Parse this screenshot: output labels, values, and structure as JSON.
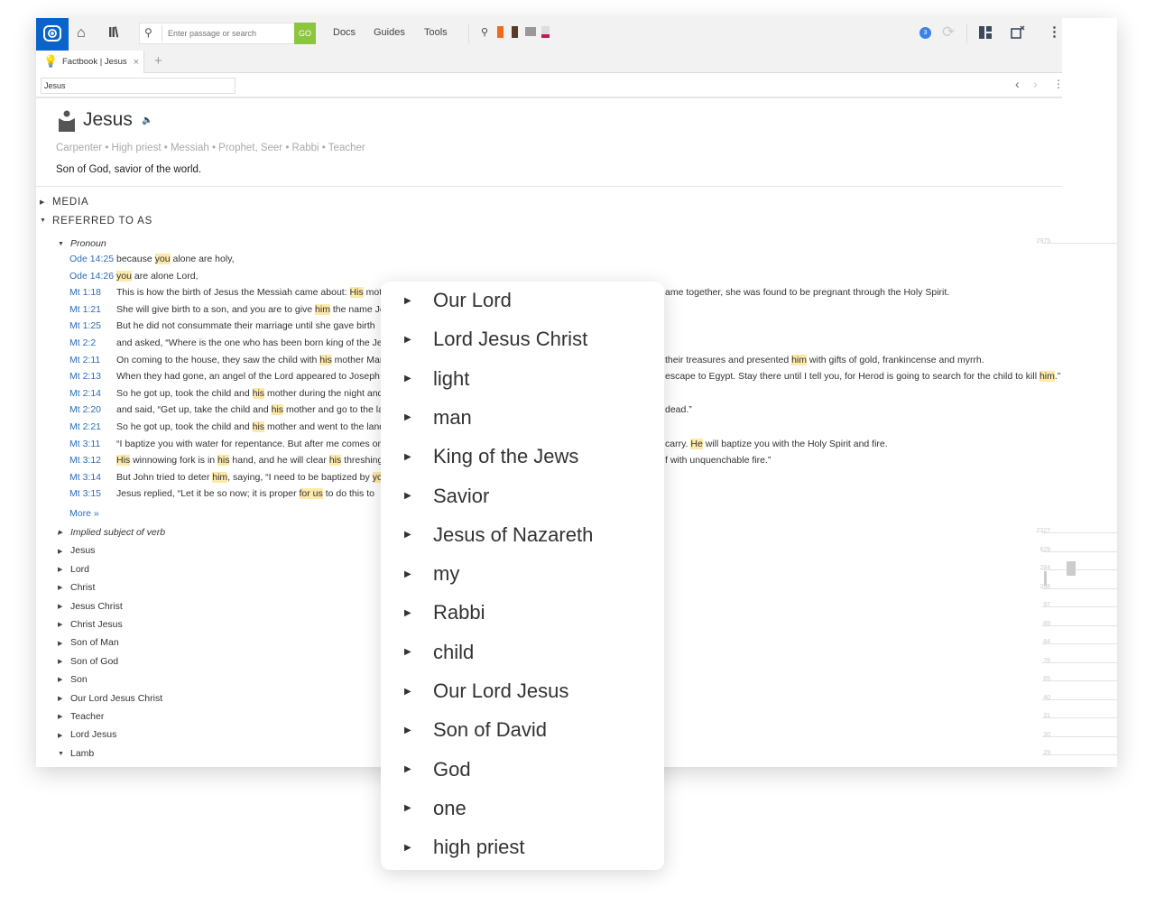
{
  "toolbar": {
    "search_placeholder": "Enter passage or search",
    "go_label": "GO",
    "nav": [
      "Docs",
      "Guides",
      "Tools"
    ],
    "notifications": "3"
  },
  "tab": {
    "label": "Factbook | Jesus",
    "close": "×",
    "add": "+"
  },
  "address": {
    "value": "Jesus"
  },
  "entry": {
    "title": "Jesus",
    "roles": "Carpenter • High priest • Messiah • Prophet, Seer • Rabbi • Teacher",
    "description": "Son of God, savior of the world."
  },
  "sections": {
    "media": "MEDIA",
    "referred": "REFERRED TO AS"
  },
  "pronoun": {
    "label": "Pronoun",
    "more": "More »",
    "verses": [
      {
        "ref": "Ode 14:25",
        "left": [
          {
            "t": "because "
          },
          {
            "t": "you",
            "hl": true
          },
          {
            "t": " alone are holy,"
          }
        ],
        "right": []
      },
      {
        "ref": "Ode 14:26",
        "left": [
          {
            "t": "you",
            "hl": true
          },
          {
            "t": " are alone Lord,"
          }
        ],
        "right": []
      },
      {
        "ref": "Mt 1:18",
        "left": [
          {
            "t": "This is how the birth of Jesus the Messiah came about: "
          },
          {
            "t": "His",
            "hl": true
          },
          {
            "t": " mother"
          }
        ],
        "right": [
          {
            "t": "ame together, she was found to be pregnant through the Holy Spirit."
          }
        ]
      },
      {
        "ref": "Mt 1:21",
        "left": [
          {
            "t": "She will give birth to a son, and you are to give "
          },
          {
            "t": "him",
            "hl": true
          },
          {
            "t": " the name Jesus"
          }
        ],
        "right": []
      },
      {
        "ref": "Mt 1:25",
        "left": [
          {
            "t": "But he did not consummate their marriage until she gave birth"
          }
        ],
        "right": []
      },
      {
        "ref": "Mt 2:2",
        "left": [
          {
            "t": "and asked, “Where is the one who has been born king of the Jews"
          }
        ],
        "right": []
      },
      {
        "ref": "Mt 2:11",
        "left": [
          {
            "t": "On coming to the house, they saw the child with "
          },
          {
            "t": "his",
            "hl": true
          },
          {
            "t": " mother Mary"
          }
        ],
        "right": [
          {
            "t": "their treasures and presented "
          },
          {
            "t": "him",
            "hl": true
          },
          {
            "t": " with gifts of gold, frankincense and myrrh."
          }
        ]
      },
      {
        "ref": "Mt 2:13",
        "left": [
          {
            "t": "When they had gone, an angel of the Lord appeared to Joseph"
          }
        ],
        "right": [
          {
            "t": "escape to Egypt. Stay there until I tell you, for Herod is going to search for the child to kill "
          },
          {
            "t": "him",
            "hl": true
          },
          {
            "t": ".”"
          }
        ]
      },
      {
        "ref": "Mt 2:14",
        "left": [
          {
            "t": "So he got up, took the child and "
          },
          {
            "t": "his",
            "hl": true
          },
          {
            "t": " mother during the night and"
          }
        ],
        "right": []
      },
      {
        "ref": "Mt 2:20",
        "left": [
          {
            "t": "and said, “Get up, take the child and "
          },
          {
            "t": "his",
            "hl": true
          },
          {
            "t": " mother and go to the land"
          }
        ],
        "right": [
          {
            "t": "dead.”"
          }
        ]
      },
      {
        "ref": "Mt 2:21",
        "left": [
          {
            "t": "So he got up, took the child and "
          },
          {
            "t": "his",
            "hl": true
          },
          {
            "t": " mother and went to the land"
          }
        ],
        "right": []
      },
      {
        "ref": "Mt 3:11",
        "left": [
          {
            "t": "“I baptize you with water for repentance. But after me comes one"
          }
        ],
        "right": [
          {
            "t": "carry. "
          },
          {
            "t": "He",
            "hl": true
          },
          {
            "t": " will baptize you with the Holy Spirit and fire."
          }
        ]
      },
      {
        "ref": "Mt 3:12",
        "left": [
          {
            "t": "His",
            "hl": true
          },
          {
            "t": " winnowing fork is in "
          },
          {
            "t": "his",
            "hl": true
          },
          {
            "t": " hand, and he will clear "
          },
          {
            "t": "his",
            "hl": true
          },
          {
            "t": " threshing"
          }
        ],
        "right": [
          {
            "t": "f with unquenchable fire.”"
          }
        ]
      },
      {
        "ref": "Mt 3:14",
        "left": [
          {
            "t": "But John tried to deter "
          },
          {
            "t": "him",
            "hl": true
          },
          {
            "t": ", saying, “I need to be baptized by "
          },
          {
            "t": "you",
            "hl": true
          }
        ],
        "right": []
      },
      {
        "ref": "Mt 3:15",
        "left": [
          {
            "t": "Jesus replied, “Let it be so now; it is proper "
          },
          {
            "t": "for us",
            "hl": true
          },
          {
            "t": " to do this to"
          }
        ],
        "right": []
      }
    ]
  },
  "other_names": [
    {
      "label": "Implied subject of verb",
      "italic": true
    },
    {
      "label": "Jesus"
    },
    {
      "label": "Lord"
    },
    {
      "label": "Christ"
    },
    {
      "label": "Jesus Christ"
    },
    {
      "label": "Christ Jesus"
    },
    {
      "label": "Son of Man"
    },
    {
      "label": "Son of God"
    },
    {
      "label": "Son"
    },
    {
      "label": "Our Lord Jesus Christ"
    },
    {
      "label": "Teacher"
    },
    {
      "label": "Lord Jesus"
    },
    {
      "label": "Lamb",
      "expanded": true
    }
  ],
  "side_chart": {
    "top_label": "2975",
    "labels": [
      "2327",
      "629",
      "284",
      "268",
      "97",
      "89",
      "84",
      "78",
      "65",
      "40",
      "31",
      "30",
      "29"
    ]
  },
  "popup": {
    "items": [
      "Our Lord",
      "Lord Jesus Christ",
      "light",
      "man",
      "King of the Jews",
      "Savior",
      "Jesus of Nazareth",
      "my",
      "Rabbi",
      "child",
      "Our Lord Jesus",
      "Son of David",
      "God",
      "one",
      "high priest"
    ]
  },
  "colors": {
    "brand": "#0a63c9",
    "go": "#8cc63f",
    "link": "#2a6ebb",
    "highlight": "#fde9a9"
  }
}
